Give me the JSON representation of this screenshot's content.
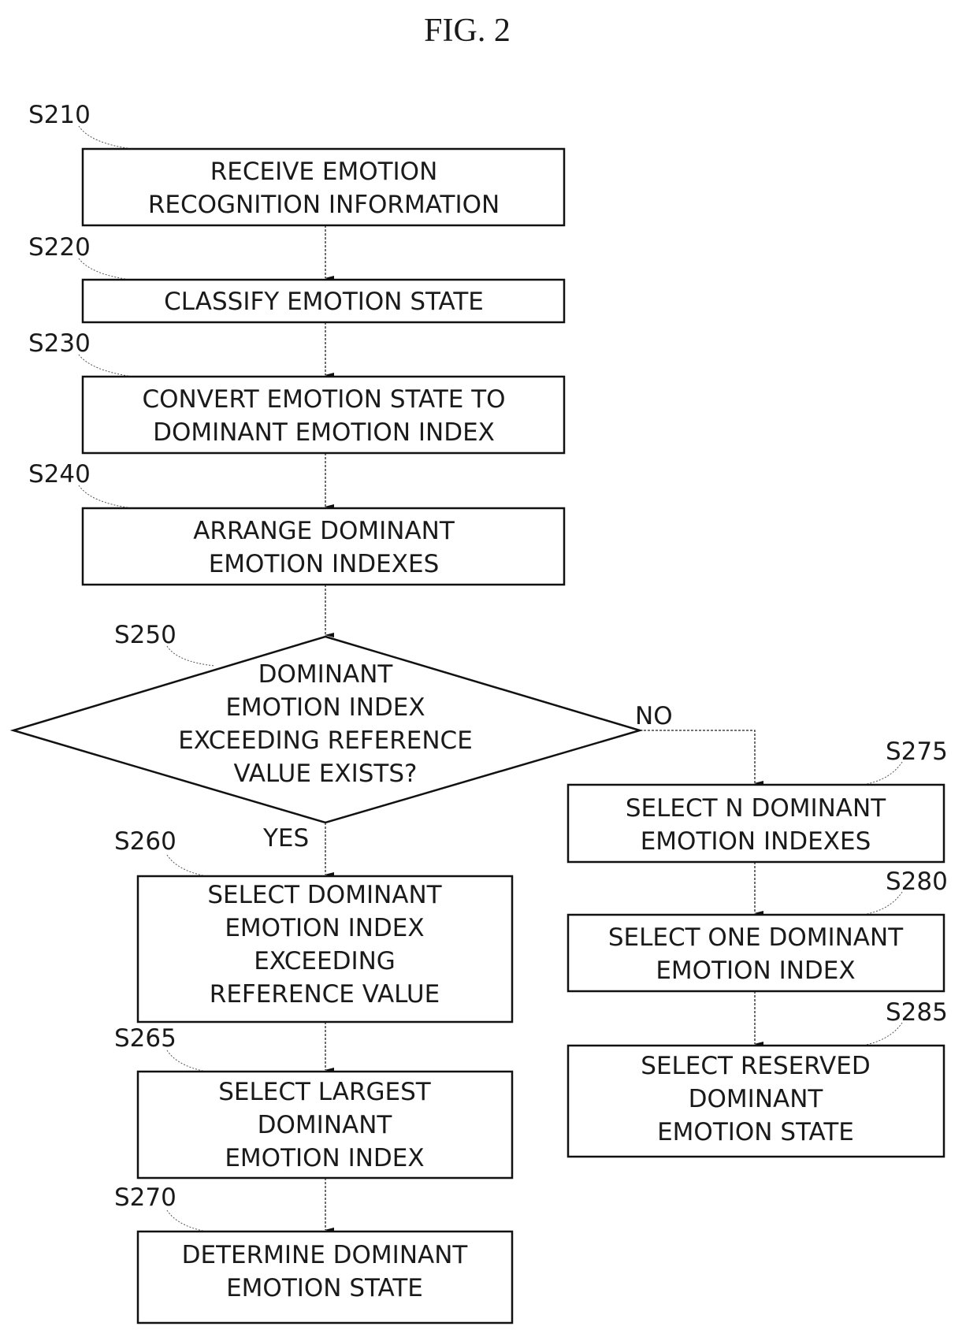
{
  "figure": {
    "title": "FIG. 2"
  },
  "steps": {
    "s210": {
      "id": "S210",
      "lines": [
        "RECEIVE EMOTION",
        "RECOGNITION INFORMATION"
      ]
    },
    "s220": {
      "id": "S220",
      "lines": [
        "CLASSIFY EMOTION STATE"
      ]
    },
    "s230": {
      "id": "S230",
      "lines": [
        "CONVERT EMOTION STATE TO",
        "DOMINANT EMOTION INDEX"
      ]
    },
    "s240": {
      "id": "S240",
      "lines": [
        "ARRANGE DOMINANT",
        "EMOTION INDEXES"
      ]
    },
    "s250": {
      "id": "S250",
      "lines": [
        "DOMINANT",
        "EMOTION INDEX",
        "EXCEEDING REFERENCE",
        "VALUE EXISTS?"
      ]
    },
    "s260": {
      "id": "S260",
      "lines": [
        "SELECT DOMINANT",
        "EMOTION INDEX",
        "EXCEEDING",
        "REFERENCE VALUE"
      ]
    },
    "s265": {
      "id": "S265",
      "lines": [
        "SELECT LARGEST",
        "DOMINANT",
        "EMOTION INDEX"
      ]
    },
    "s270": {
      "id": "S270",
      "lines": [
        "DETERMINE DOMINANT",
        "EMOTION STATE"
      ]
    },
    "s275": {
      "id": "S275",
      "lines": [
        "SELECT N DOMINANT",
        "EMOTION INDEXES"
      ]
    },
    "s280": {
      "id": "S280",
      "lines": [
        "SELECT ONE DOMINANT",
        "EMOTION INDEX"
      ]
    },
    "s285": {
      "id": "S285",
      "lines": [
        "SELECT RESERVED",
        "DOMINANT",
        "EMOTION STATE"
      ]
    }
  },
  "branches": {
    "yes": "YES",
    "no": "NO"
  }
}
